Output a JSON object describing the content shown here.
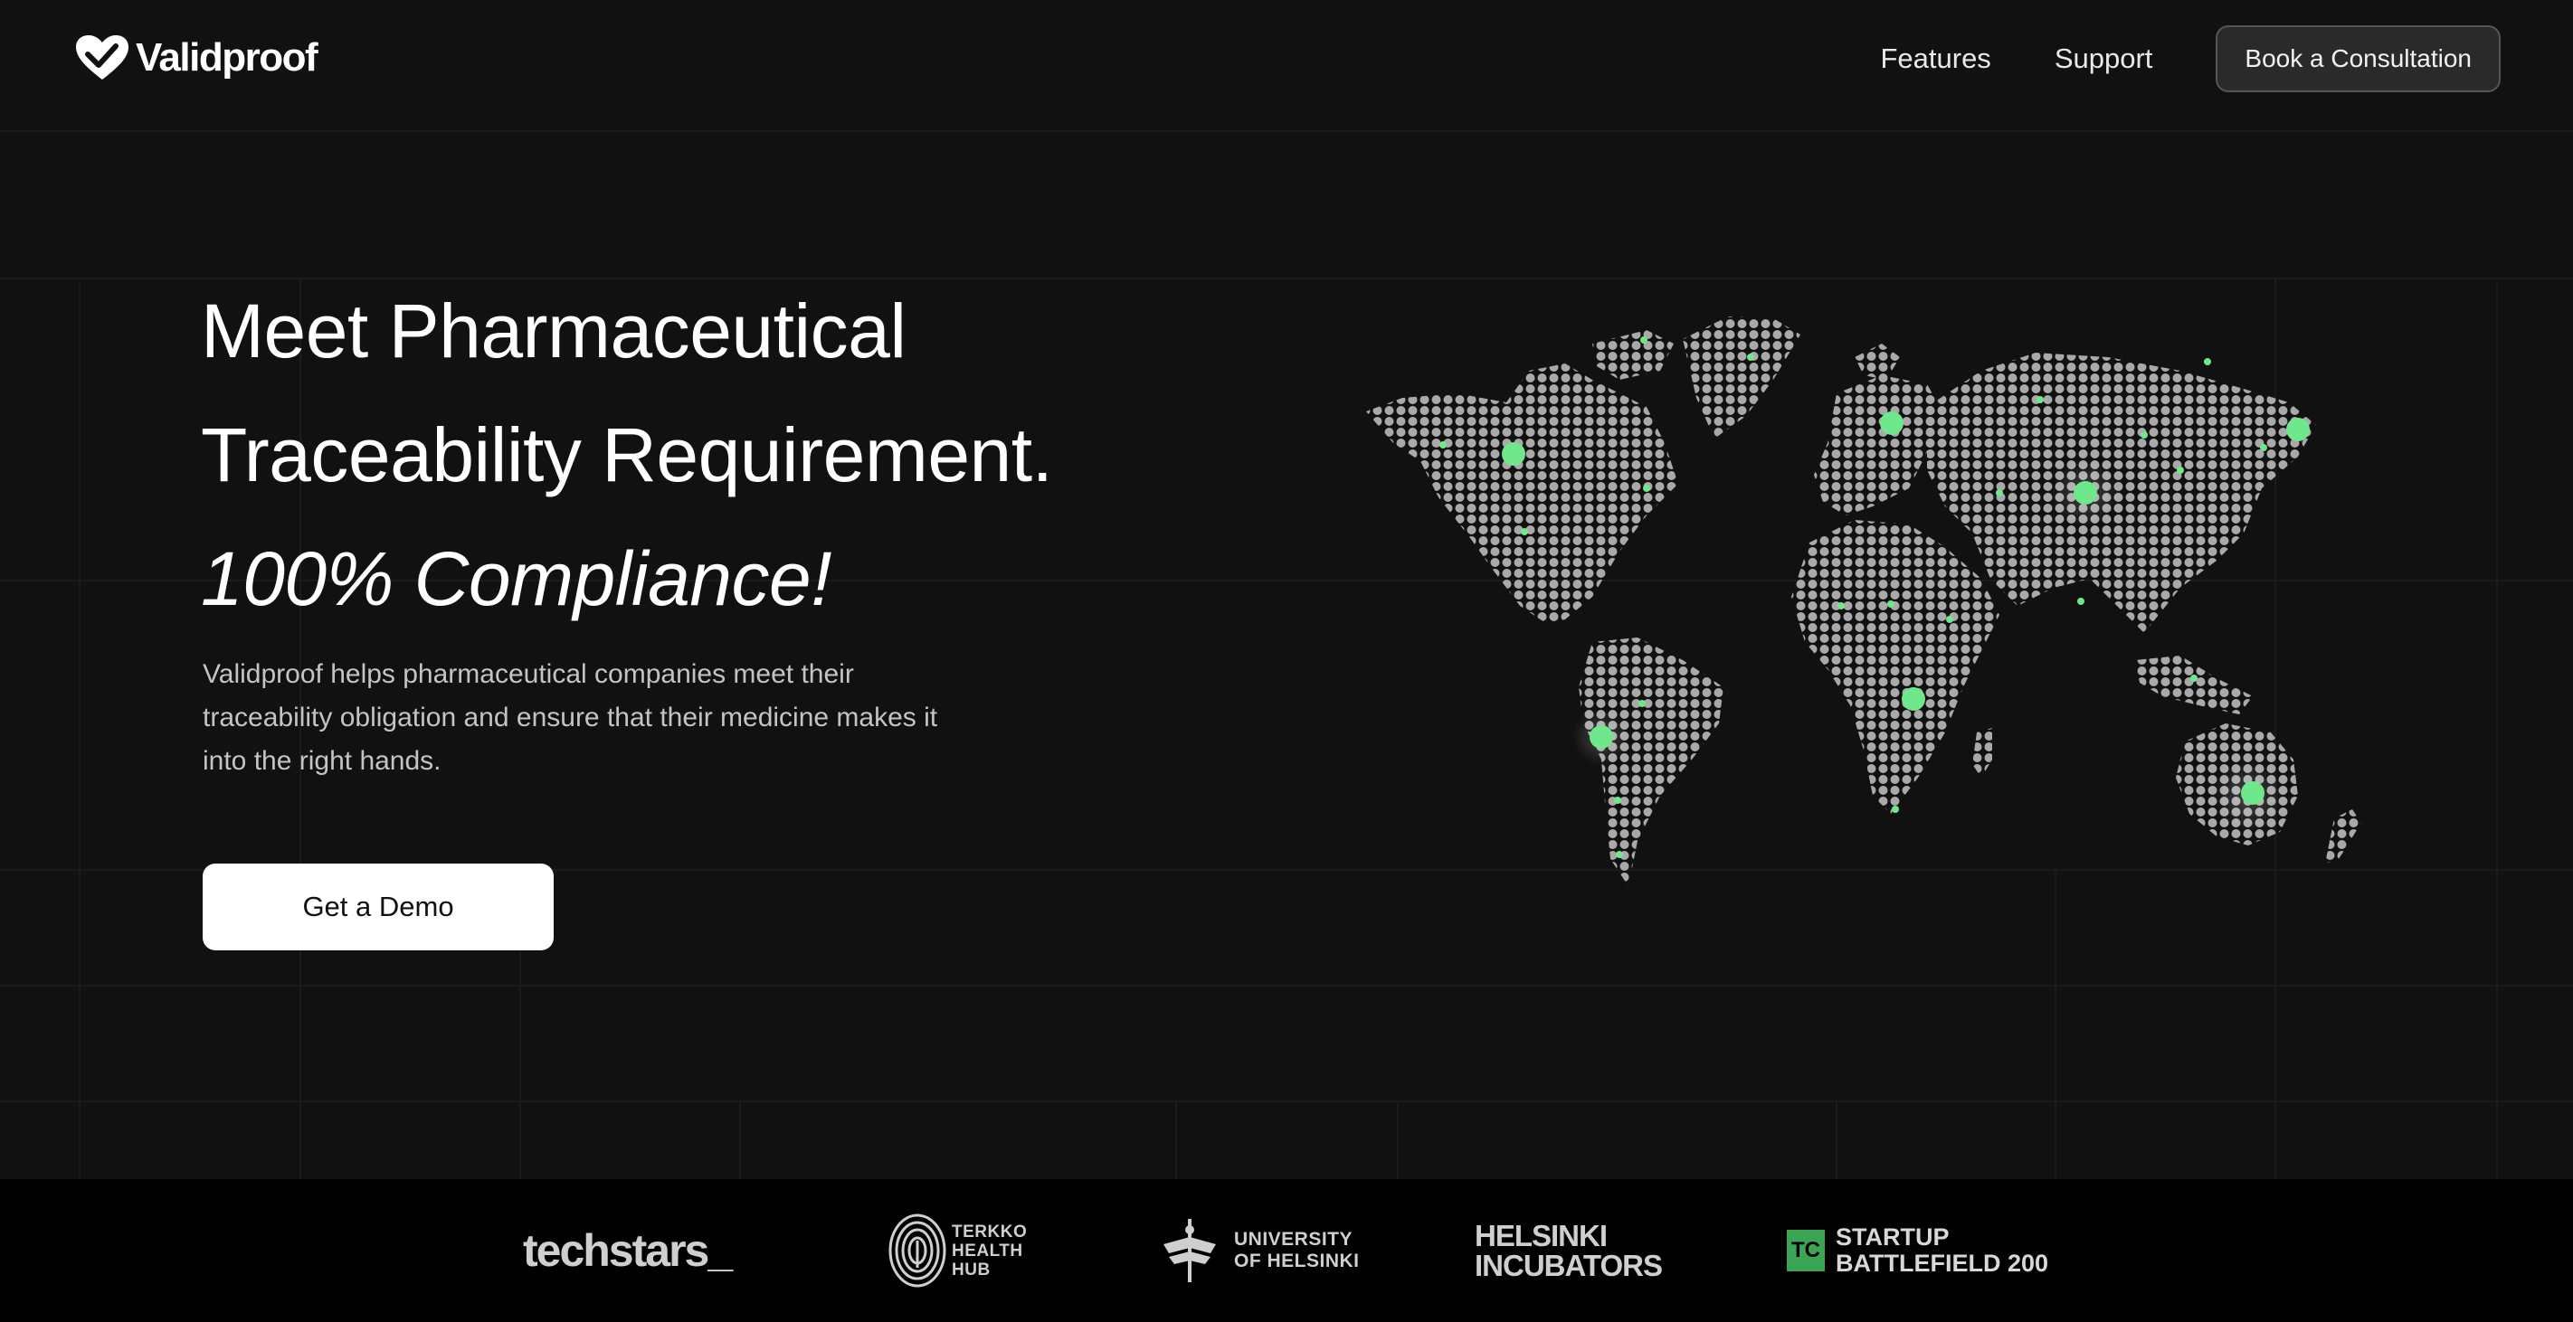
{
  "header": {
    "brand": "Validproof",
    "nav": [
      {
        "label": "Features"
      },
      {
        "label": "Support"
      }
    ],
    "cta_label": "Book a Consultation"
  },
  "hero": {
    "title_line1": "Meet Pharmaceutical",
    "title_line2": "Traceability Requirement.",
    "title_line3": "100% Compliance!",
    "description": "Validproof helps pharmaceutical companies meet their traceability obligation and ensure that their medicine makes it into the right hands.",
    "cta_label": "Get a Demo"
  },
  "partners": {
    "techstars": "techstars_",
    "terkko": [
      "TERKKO",
      "HEALTH",
      "HUB"
    ],
    "helsinki_uni": [
      "UNIVERSITY",
      "OF HELSINKI"
    ],
    "incubators": [
      "HELSINKI",
      "INCUBATORS"
    ],
    "tc_mark": "TC",
    "battlefield": [
      "STARTUP",
      "BATTLEFIELD 200"
    ]
  },
  "colors": {
    "background": "#111111",
    "accent_green": "#6ee88a",
    "map_dot": "#a9a9a9",
    "partner_bar": "#000000"
  }
}
